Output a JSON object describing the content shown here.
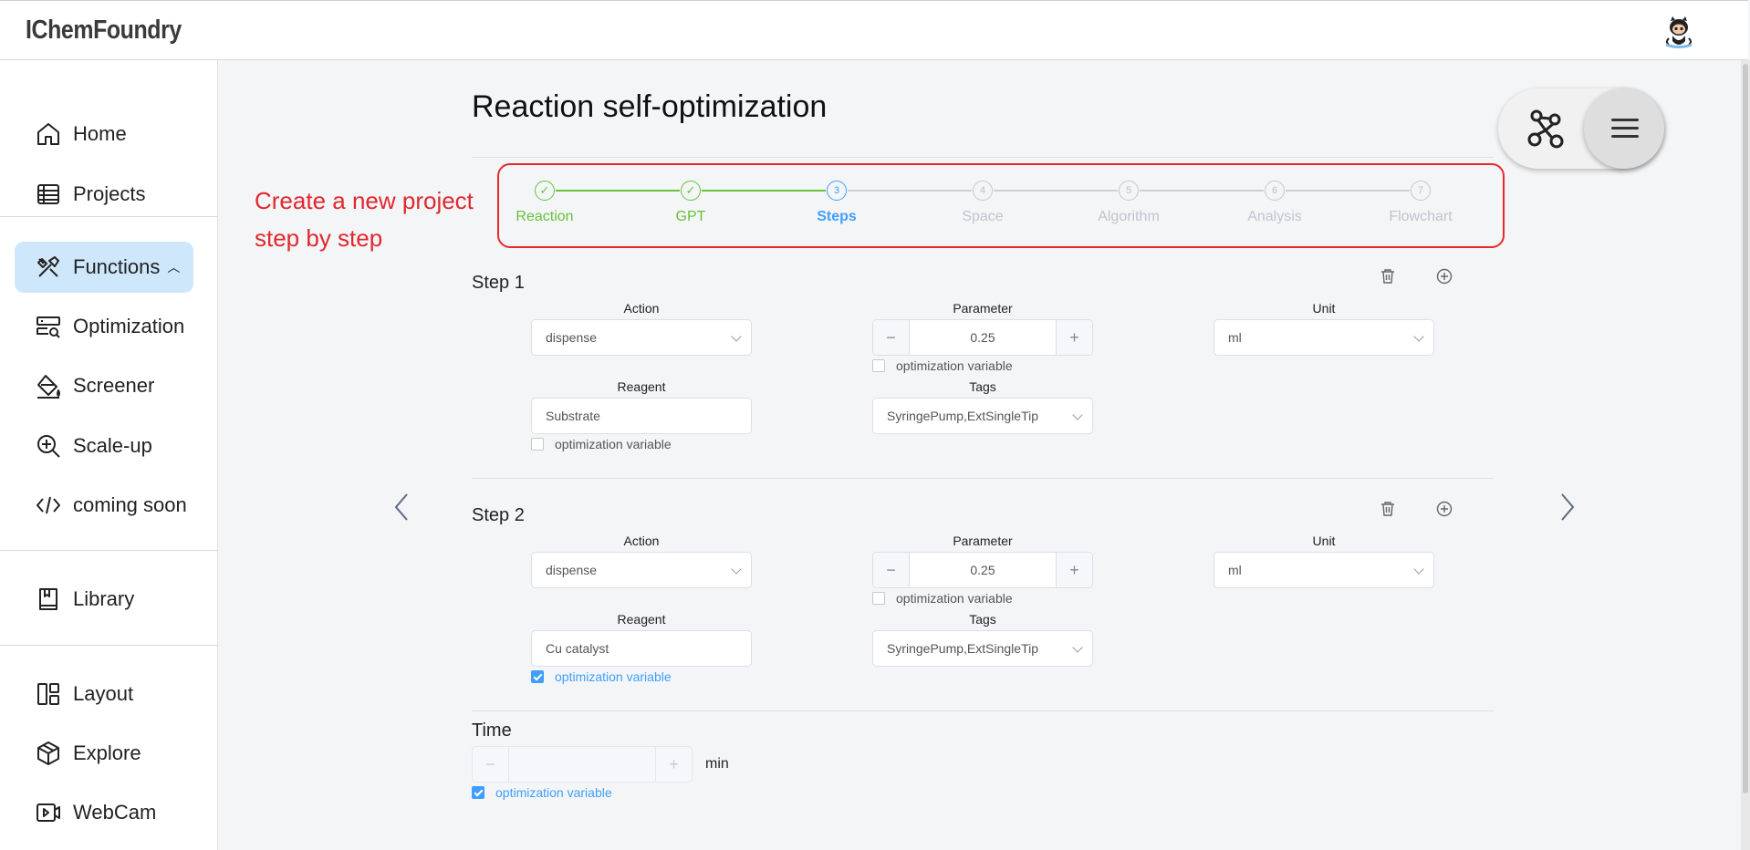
{
  "app": {
    "brand": "IChemFoundry"
  },
  "sidebar": {
    "items": [
      {
        "label": "Home",
        "icon": "home-icon"
      },
      {
        "label": "Projects",
        "icon": "table-icon"
      },
      {
        "label": "Functions",
        "icon": "tools-icon",
        "active": true
      },
      {
        "label": "Optimization",
        "icon": "server-search-icon"
      },
      {
        "label": "Screener",
        "icon": "paint-bucket-icon"
      },
      {
        "label": "Scale-up",
        "icon": "zoom-in-icon"
      },
      {
        "label": "coming soon",
        "icon": "code-icon"
      },
      {
        "label": "Library",
        "icon": "book-icon"
      },
      {
        "label": "Layout",
        "icon": "layout-icon"
      },
      {
        "label": "Explore",
        "icon": "cube-icon"
      },
      {
        "label": "WebCam",
        "icon": "webcam-icon"
      }
    ]
  },
  "page": {
    "title": "Reaction self-optimization"
  },
  "callout": {
    "line1": "Create a new project",
    "line2": "step by step",
    "color": "#e0282e"
  },
  "stepper": {
    "steps": [
      {
        "number": "1",
        "label": "Reaction",
        "status": "done"
      },
      {
        "number": "2",
        "label": "GPT",
        "status": "done"
      },
      {
        "number": "3",
        "label": "Steps",
        "status": "current"
      },
      {
        "number": "4",
        "label": "Space",
        "status": "pending"
      },
      {
        "number": "5",
        "label": "Algorithm",
        "status": "pending"
      },
      {
        "number": "6",
        "label": "Analysis",
        "status": "pending"
      },
      {
        "number": "7",
        "label": "Flowchart",
        "status": "pending"
      }
    ]
  },
  "labels": {
    "action": "Action",
    "parameter": "Parameter",
    "unit": "Unit",
    "reagent": "Reagent",
    "tags": "Tags",
    "optimization_variable": "optimization variable",
    "minus": "−",
    "plus": "+"
  },
  "steps": [
    {
      "title": "Step 1",
      "action": "dispense",
      "parameter": "0.25",
      "parameter_opt": false,
      "unit": "ml",
      "reagent": "Substrate",
      "reagent_opt": false,
      "tags": "SyringePump,ExtSingleTip"
    },
    {
      "title": "Step 2",
      "action": "dispense",
      "parameter": "0.25",
      "parameter_opt": false,
      "unit": "ml",
      "reagent": "Cu catalyst",
      "reagent_opt": true,
      "tags": "SyringePump,ExtSingleTip"
    }
  ],
  "time": {
    "title": "Time",
    "value": "",
    "unit": "min",
    "opt_checked": true
  },
  "colors": {
    "accent": "#409eff",
    "success": "#67c23a",
    "active_nav": "#cfe7fb"
  }
}
